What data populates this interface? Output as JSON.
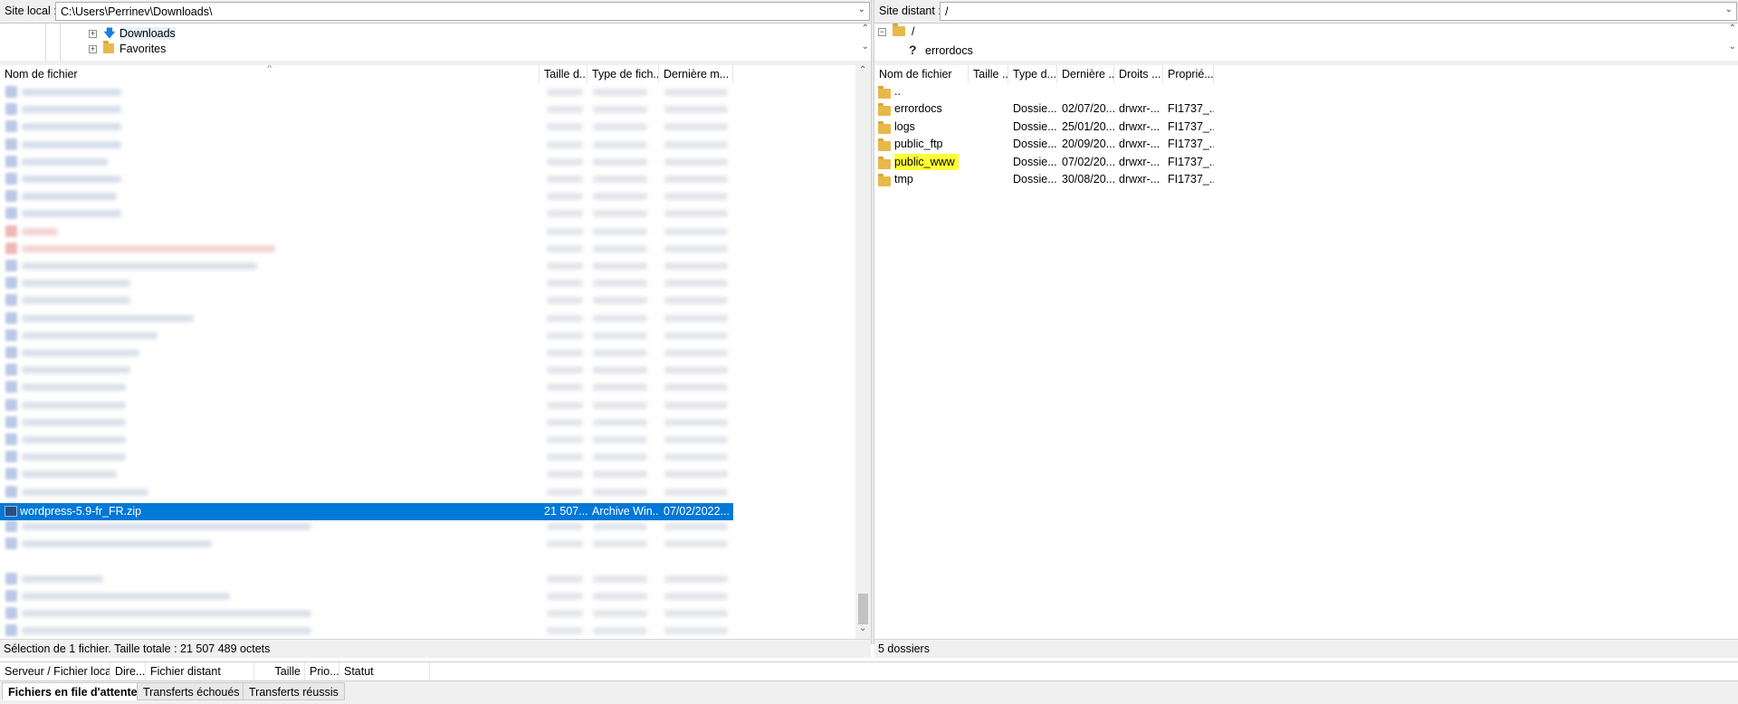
{
  "local": {
    "site_label": "Site local :",
    "path": "C:\\Users\\Perrinev\\Downloads\\",
    "tree": [
      {
        "label": "Downloads",
        "icon": "download-arrow-icon"
      },
      {
        "label": "Favorites",
        "icon": "star-folder-icon"
      }
    ],
    "columns": [
      "Nom de fichier",
      "Taille d...",
      "Type de fich...",
      "Dernière m..."
    ],
    "selected_file": {
      "name": "wordpress-5.9-fr_FR.zip",
      "size": "21 507...",
      "type": "Archive Win...",
      "modified": "07/02/2022..."
    },
    "status": "Sélection de 1 fichier. Taille totale : 21 507 489 octets"
  },
  "remote": {
    "site_label": "Site distant :",
    "path": "/",
    "tree": [
      {
        "label": "/",
        "icon": "folder-icon"
      },
      {
        "label": "errordocs",
        "icon": "question-icon"
      }
    ],
    "columns": [
      "Nom de fichier",
      "Taille ...",
      "Type d...",
      "Dernière ...",
      "Droits ...",
      "Proprié..."
    ],
    "parent": "..",
    "rows": [
      {
        "name": "errordocs",
        "type": "Dossie...",
        "modified": "02/07/20...",
        "perms": "drwxr-...",
        "owner": "FI1737_..."
      },
      {
        "name": "logs",
        "type": "Dossie...",
        "modified": "25/01/20...",
        "perms": "drwxr-...",
        "owner": "FI1737_..."
      },
      {
        "name": "public_ftp",
        "type": "Dossie...",
        "modified": "20/09/20...",
        "perms": "drwxr-...",
        "owner": "FI1737_..."
      },
      {
        "name": "public_www",
        "type": "Dossie...",
        "modified": "07/02/20...",
        "perms": "drwxr-...",
        "owner": "FI1737_...",
        "highlight": true
      },
      {
        "name": "tmp",
        "type": "Dossie...",
        "modified": "30/08/20...",
        "perms": "drwxr-...",
        "owner": "FI1737_..."
      }
    ],
    "status": "5 dossiers"
  },
  "queue": {
    "columns": [
      "Serveur / Fichier local",
      "Dire...",
      "Fichier distant",
      "Taille",
      "Prio...",
      "Statut"
    ],
    "tabs": [
      "Fichiers en file d'attente",
      "Transferts échoués",
      "Transferts réussis"
    ]
  },
  "colors": {
    "selection": "#0078d7",
    "highlight": "#ffff33",
    "folder": "#e8b84a"
  }
}
